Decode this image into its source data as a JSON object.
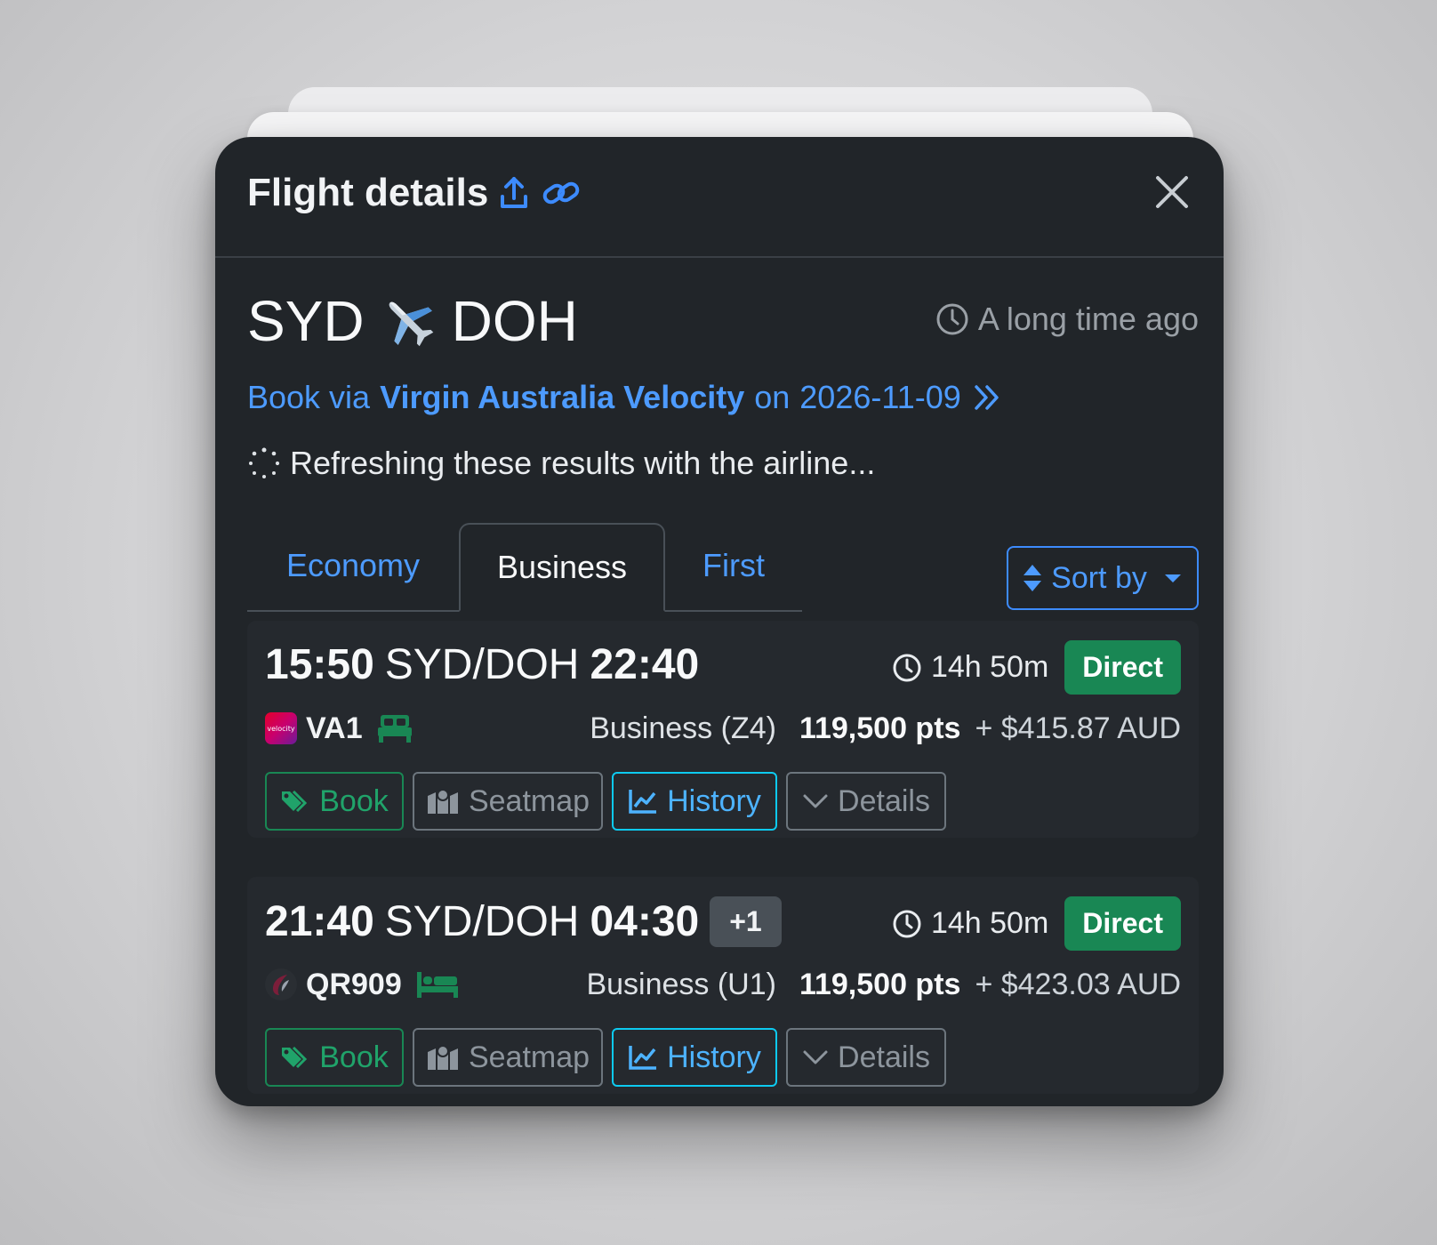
{
  "modal": {
    "title": "Flight details",
    "close_label": "Close",
    "route": {
      "origin": "SYD",
      "destination": "DOH",
      "plane_emoji": "✈️"
    },
    "last_updated": "A long time ago",
    "book_via": {
      "prefix": "Book via",
      "program": "Virgin Australia Velocity",
      "on": "on",
      "date": "2026-11-09"
    },
    "refresh_text": "Refreshing these results with the airline...",
    "tabs": [
      {
        "label": "Economy",
        "active": false
      },
      {
        "label": "Business",
        "active": true
      },
      {
        "label": "First",
        "active": false
      }
    ],
    "sort_label": "Sort by"
  },
  "flights": [
    {
      "depart": "15:50",
      "route": "SYD/DOH",
      "arrive": "22:40",
      "day_offset": "",
      "duration": "14h 50m",
      "stops": "Direct",
      "airline_logo": "velocity-logo",
      "logo_text": "velocity",
      "flight_no": "VA1",
      "seat_icon": "flat-bed-icon",
      "cabin": "Business (Z4)",
      "points": "119,500 pts",
      "cash": "+ $415.87 AUD",
      "buttons": {
        "book": "Book",
        "seatmap": "Seatmap",
        "history": "History",
        "details": "Details"
      }
    },
    {
      "depart": "21:40",
      "route": "SYD/DOH",
      "arrive": "04:30",
      "day_offset": "+1",
      "duration": "14h 50m",
      "stops": "Direct",
      "airline_logo": "qatar-logo",
      "flight_no": "QR909",
      "seat_icon": "bed-icon",
      "cabin": "Business (U1)",
      "points": "119,500 pts",
      "cash": "+ $423.03 AUD",
      "buttons": {
        "book": "Book",
        "seatmap": "Seatmap",
        "history": "History",
        "details": "Details"
      }
    }
  ],
  "colors": {
    "accent": "#4d9bff",
    "success": "#198754",
    "info": "#0dcaf0",
    "panel": "#212529"
  }
}
